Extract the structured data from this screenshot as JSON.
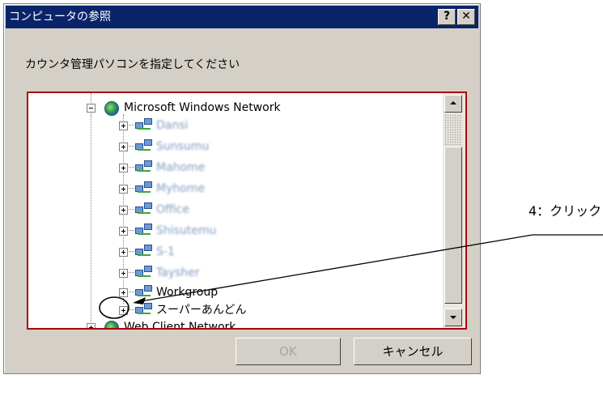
{
  "dialog": {
    "title": "コンピュータの参照",
    "help_button_label": "?",
    "close_button_label": "✕",
    "instruction": "カウンタ管理パソコンを指定してください",
    "ok_label": "OK",
    "cancel_label": "キャンセル"
  },
  "tree": {
    "root_label": "Microsoft Windows Network",
    "children": [
      {
        "label": "Dansi",
        "blurred": true
      },
      {
        "label": "Sunsumu",
        "blurred": true
      },
      {
        "label": "Mahome",
        "blurred": true
      },
      {
        "label": "Myhome",
        "blurred": true
      },
      {
        "label": "Office",
        "blurred": true
      },
      {
        "label": "Shisutemu",
        "blurred": true
      },
      {
        "label": "S-1",
        "blurred": true
      },
      {
        "label": "Taysher",
        "blurred": true
      },
      {
        "label": "Workgroup",
        "blurred": false
      },
      {
        "label": "スーパーあんどん",
        "blurred": false
      }
    ],
    "next_root_label": "Web Client Network"
  },
  "annotation": {
    "step_label": "4：クリック",
    "color": "#000000"
  },
  "colors": {
    "titlebar": "#0a246a",
    "dialog_face": "#d4d0c8",
    "tree_border": "#b00000"
  },
  "icons": {
    "root": "globe-network-icon",
    "child": "network-group-icon"
  }
}
